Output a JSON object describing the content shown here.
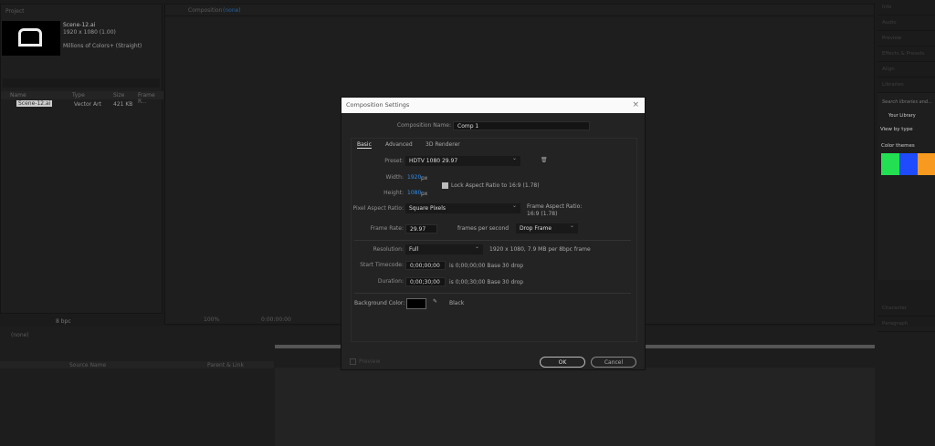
{
  "project": {
    "title": "Project",
    "filename": "Scene-12.ai",
    "dims": "1920 x 1080 (1.00)",
    "colors": "Millions of Colors+ (Straight)",
    "columns": [
      "Name",
      "Type",
      "Size",
      "Frame R..."
    ],
    "row": {
      "name": "Scene-12.ai",
      "type": "Vector Art",
      "size": "421 KB"
    },
    "bpc": "8 bpc"
  },
  "composition": {
    "label": "Composition",
    "value": "(none)",
    "zoom": "100%",
    "timecode": "0:00:00:00"
  },
  "timeline": {
    "tab": "(none)",
    "columns": [
      "Source Name",
      "Parent & Link"
    ]
  },
  "right": {
    "panels": [
      "Info",
      "Audio",
      "Preview",
      "Effects & Presets",
      "Align",
      "Libraries"
    ],
    "search_placeholder": "Search libraries and...",
    "library": "Your Library",
    "view_by": "View by type",
    "themes": "Color themes",
    "swatches": [
      "#22e052",
      "#1f4bff",
      "#f99a20"
    ],
    "bottom": [
      "Character",
      "Paragraph"
    ]
  },
  "dialog": {
    "title": "Composition Settings",
    "comp_name_label": "Composition Name:",
    "comp_name": "Comp 1",
    "tabs": [
      "Basic",
      "Advanced",
      "3D Renderer"
    ],
    "preset_label": "Preset:",
    "preset": "HDTV 1080 29.97",
    "width_label": "Width:",
    "width": "1920",
    "height_label": "Height:",
    "height": "1080",
    "px": "px",
    "lock": "Lock Aspect Ratio to 16:9 (1.78)",
    "par_label": "Pixel Aspect Ratio:",
    "par": "Square Pixels",
    "far_label": "Frame Aspect Ratio:",
    "far": "16:9 (1.78)",
    "fr_label": "Frame Rate:",
    "fr": "29.97",
    "fps": "frames per second",
    "drop": "Drop Frame",
    "res_label": "Resolution:",
    "res": "Full",
    "res_info": "1920 x 1080, 7.9 MB per 8bpc frame",
    "start_label": "Start Timecode:",
    "start": "0;00;00;00",
    "start_info": "is 0;00;00;00  Base 30  drop",
    "dur_label": "Duration:",
    "dur": "0;00;30;00",
    "dur_info": "is 0;00;30;00  Base 30  drop",
    "bg_label": "Background Color:",
    "bg_name": "Black",
    "preview": "Preview",
    "ok": "OK",
    "cancel": "Cancel"
  }
}
